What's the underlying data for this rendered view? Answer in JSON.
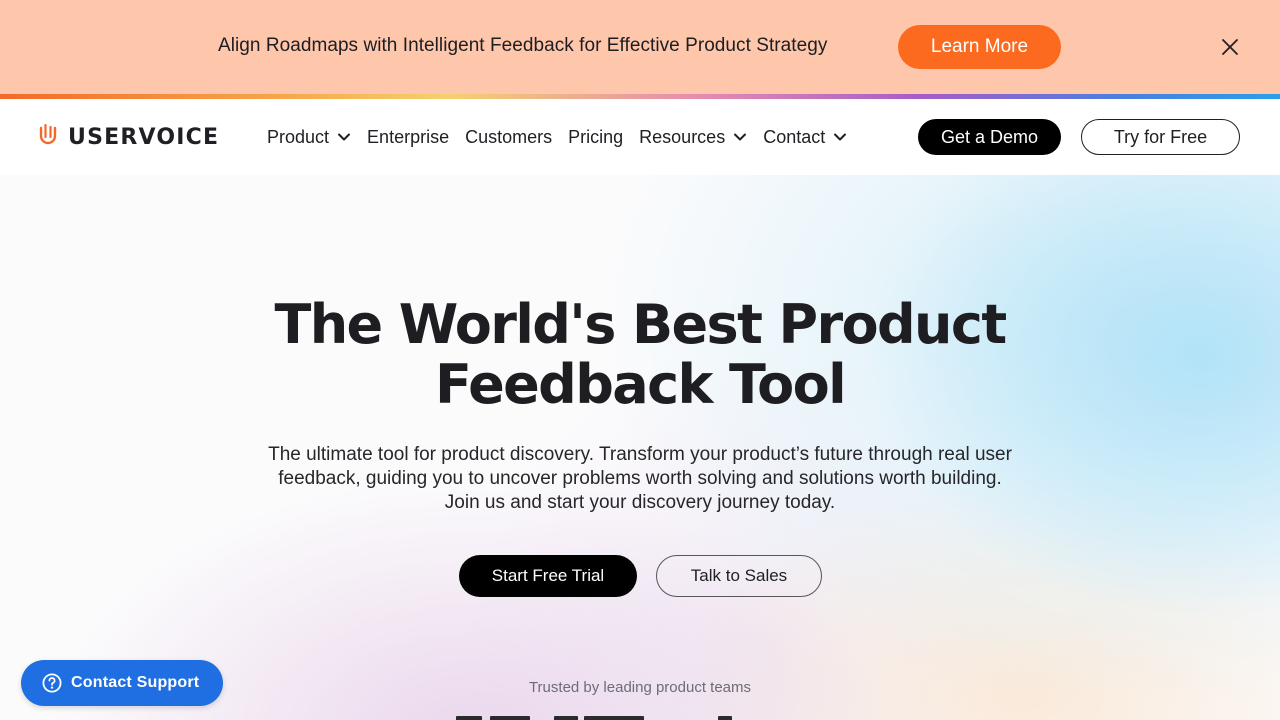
{
  "banner": {
    "text": "Align Roadmaps with Intelligent Feedback for Effective Product Strategy",
    "button_label": "Learn More",
    "close_icon": "close-icon",
    "background": "#fec6ab",
    "button_color": "#fb6a1e"
  },
  "nav": {
    "logo_text": "USERVOICE",
    "logo_color": "#f26a2a",
    "items": [
      {
        "label": "Product",
        "has_dropdown": true
      },
      {
        "label": "Enterprise",
        "has_dropdown": false
      },
      {
        "label": "Customers",
        "has_dropdown": false
      },
      {
        "label": "Pricing",
        "has_dropdown": false
      },
      {
        "label": "Resources",
        "has_dropdown": true
      },
      {
        "label": "Contact",
        "has_dropdown": true
      }
    ],
    "demo_label": "Get a Demo",
    "try_label": "Try for Free"
  },
  "hero": {
    "title_line1": "The World's Best Product",
    "title_line2": "Feedback Tool",
    "subtitle_line1": "The ultimate tool for product discovery. Transform your product’s future through real user",
    "subtitle_line2": "feedback, guiding you to uncover problems worth solving and solutions worth building.",
    "subtitle_line3": "Join us and start your discovery journey today.",
    "primary_cta": "Start Free Trial",
    "secondary_cta": "Talk to Sales",
    "trusted_text": "Trusted by leading product teams"
  },
  "support": {
    "label": "Contact Support",
    "icon": "question-circle-icon",
    "color": "#1f6fe2"
  }
}
